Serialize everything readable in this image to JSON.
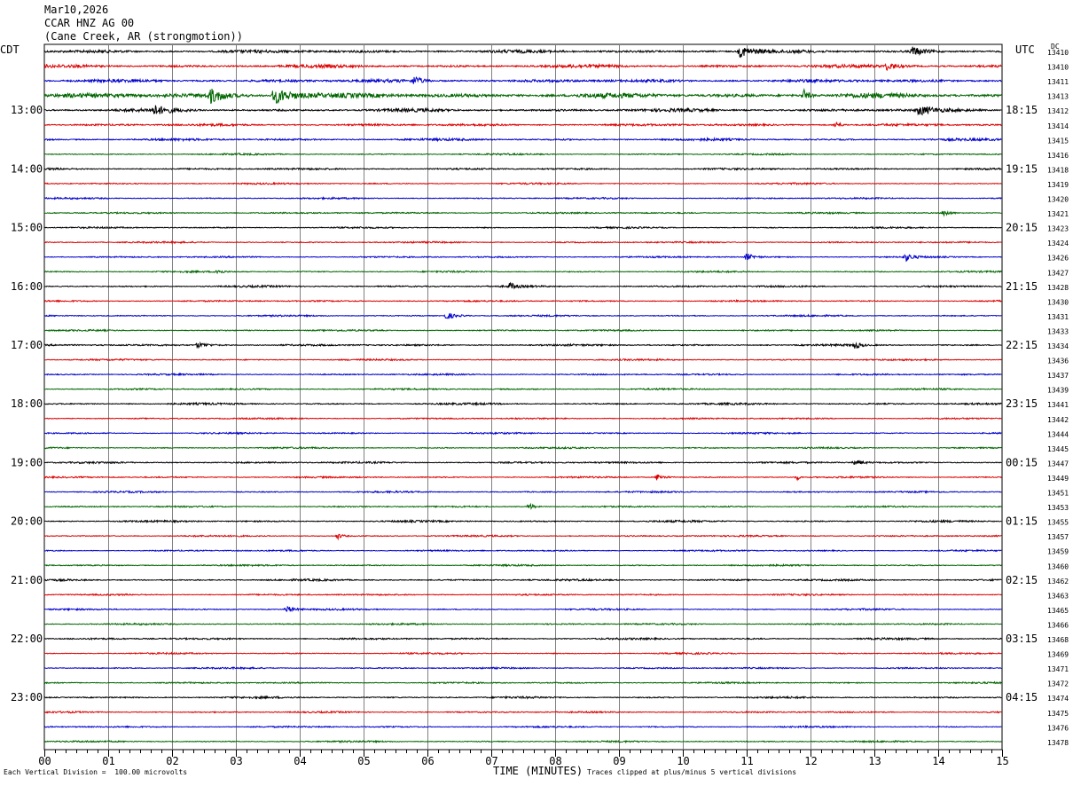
{
  "header": {
    "date": "Mar10,2026",
    "station": "CCAR HNZ AG 00",
    "location": "(Cane Creek, AR (strongmotion))"
  },
  "left_tz": "CDT",
  "right_tz": "UTC",
  "dc_label": "DC",
  "footer": {
    "scale_note": "Each Vertical Division =  100.00 microvolts",
    "clip_note": "Traces clipped at plus/minus 5 vertical divisions"
  },
  "colors": {
    "trace_cycle": [
      "#000000",
      "#dd0000",
      "#0000cc",
      "#006600"
    ],
    "grid": "#808080"
  },
  "chart_data": {
    "type": "line",
    "xlabel": "TIME (MINUTES)",
    "xlim": [
      0,
      15
    ],
    "x_ticks": [
      "00",
      "01",
      "02",
      "03",
      "04",
      "05",
      "06",
      "07",
      "08",
      "09",
      "10",
      "11",
      "12",
      "13",
      "14",
      "15"
    ],
    "left_time_labels": [
      {
        "trace": 4,
        "label": "13:00"
      },
      {
        "trace": 8,
        "label": "14:00"
      },
      {
        "trace": 12,
        "label": "15:00"
      },
      {
        "trace": 16,
        "label": "16:00"
      },
      {
        "trace": 20,
        "label": "17:00"
      },
      {
        "trace": 24,
        "label": "18:00"
      },
      {
        "trace": 28,
        "label": "19:00"
      },
      {
        "trace": 32,
        "label": "20:00"
      },
      {
        "trace": 36,
        "label": "21:00"
      },
      {
        "trace": 40,
        "label": "22:00"
      },
      {
        "trace": 44,
        "label": "23:00"
      }
    ],
    "right_time_labels": [
      {
        "trace": 4,
        "label": "18:15"
      },
      {
        "trace": 8,
        "label": "19:15"
      },
      {
        "trace": 12,
        "label": "20:15"
      },
      {
        "trace": 16,
        "label": "21:15"
      },
      {
        "trace": 20,
        "label": "22:15"
      },
      {
        "trace": 24,
        "label": "23:15"
      },
      {
        "trace": 28,
        "label": "00:15"
      },
      {
        "trace": 32,
        "label": "01:15"
      },
      {
        "trace": 36,
        "label": "02:15"
      },
      {
        "trace": 40,
        "label": "03:15"
      },
      {
        "trace": 44,
        "label": "04:15"
      }
    ],
    "dc_offsets": [
      "13410",
      "13410",
      "13411",
      "13413",
      "13412",
      "13414",
      "13415",
      "13416",
      "13418",
      "13419",
      "13420",
      "13421",
      "13423",
      "13424",
      "13426",
      "13427",
      "13428",
      "13430",
      "13431",
      "13433",
      "13434",
      "13436",
      "13437",
      "13439",
      "13441",
      "13442",
      "13444",
      "13445",
      "13447",
      "13449",
      "13451",
      "13453",
      "13455",
      "13457",
      "13459",
      "13460",
      "13462",
      "13463",
      "13465",
      "13466",
      "13468",
      "13469",
      "13471",
      "13472",
      "13474",
      "13475",
      "13476",
      "13478"
    ],
    "traces": 48,
    "noise_level": [
      2,
      2,
      2,
      3,
      2,
      1.5,
      1.5,
      1,
      1.2,
      1,
      1,
      1,
      1,
      1,
      1,
      1,
      1.2,
      1,
      1,
      1,
      1.2,
      1,
      1,
      1,
      1.2,
      1,
      1,
      1,
      1.2,
      1,
      1,
      1,
      1.2,
      1,
      1,
      1,
      1.2,
      1,
      1,
      1,
      1.2,
      1,
      1,
      1,
      1.2,
      1,
      1,
      1
    ],
    "events": [
      {
        "trace": 0,
        "minute": 10.9,
        "amp": 6,
        "dur": 0.5
      },
      {
        "trace": 0,
        "minute": 13.6,
        "amp": 5,
        "dur": 0.5
      },
      {
        "trace": 1,
        "minute": 13.2,
        "amp": 4,
        "dur": 0.5
      },
      {
        "trace": 2,
        "minute": 5.8,
        "amp": 5,
        "dur": 0.3
      },
      {
        "trace": 3,
        "minute": 2.6,
        "amp": 8,
        "dur": 0.6
      },
      {
        "trace": 3,
        "minute": 3.6,
        "amp": 9,
        "dur": 0.8
      },
      {
        "trace": 3,
        "minute": 11.9,
        "amp": 6,
        "dur": 0.2
      },
      {
        "trace": 4,
        "minute": 1.7,
        "amp": 5,
        "dur": 0.6
      },
      {
        "trace": 4,
        "minute": 13.7,
        "amp": 5,
        "dur": 0.5
      },
      {
        "trace": 5,
        "minute": 12.4,
        "amp": 4,
        "dur": 0.2
      },
      {
        "trace": 11,
        "minute": 14.1,
        "amp": 4,
        "dur": 0.2
      },
      {
        "trace": 14,
        "minute": 11.0,
        "amp": 4,
        "dur": 0.3
      },
      {
        "trace": 14,
        "minute": 13.5,
        "amp": 4,
        "dur": 0.3
      },
      {
        "trace": 15,
        "minute": 2.7,
        "amp": 3,
        "dur": 0.2
      },
      {
        "trace": 16,
        "minute": 7.3,
        "amp": 4,
        "dur": 0.2
      },
      {
        "trace": 18,
        "minute": 6.3,
        "amp": 4,
        "dur": 0.4
      },
      {
        "trace": 20,
        "minute": 2.4,
        "amp": 3,
        "dur": 0.5
      },
      {
        "trace": 20,
        "minute": 12.7,
        "amp": 4,
        "dur": 0.2
      },
      {
        "trace": 28,
        "minute": 12.7,
        "amp": 3,
        "dur": 0.3
      },
      {
        "trace": 29,
        "minute": 9.6,
        "amp": 4,
        "dur": 0.3
      },
      {
        "trace": 29,
        "minute": 11.8,
        "amp": 3,
        "dur": 0.1
      },
      {
        "trace": 31,
        "minute": 7.6,
        "amp": 4,
        "dur": 0.2
      },
      {
        "trace": 33,
        "minute": 4.6,
        "amp": 3,
        "dur": 0.2
      },
      {
        "trace": 38,
        "minute": 3.8,
        "amp": 4,
        "dur": 0.3
      }
    ]
  }
}
